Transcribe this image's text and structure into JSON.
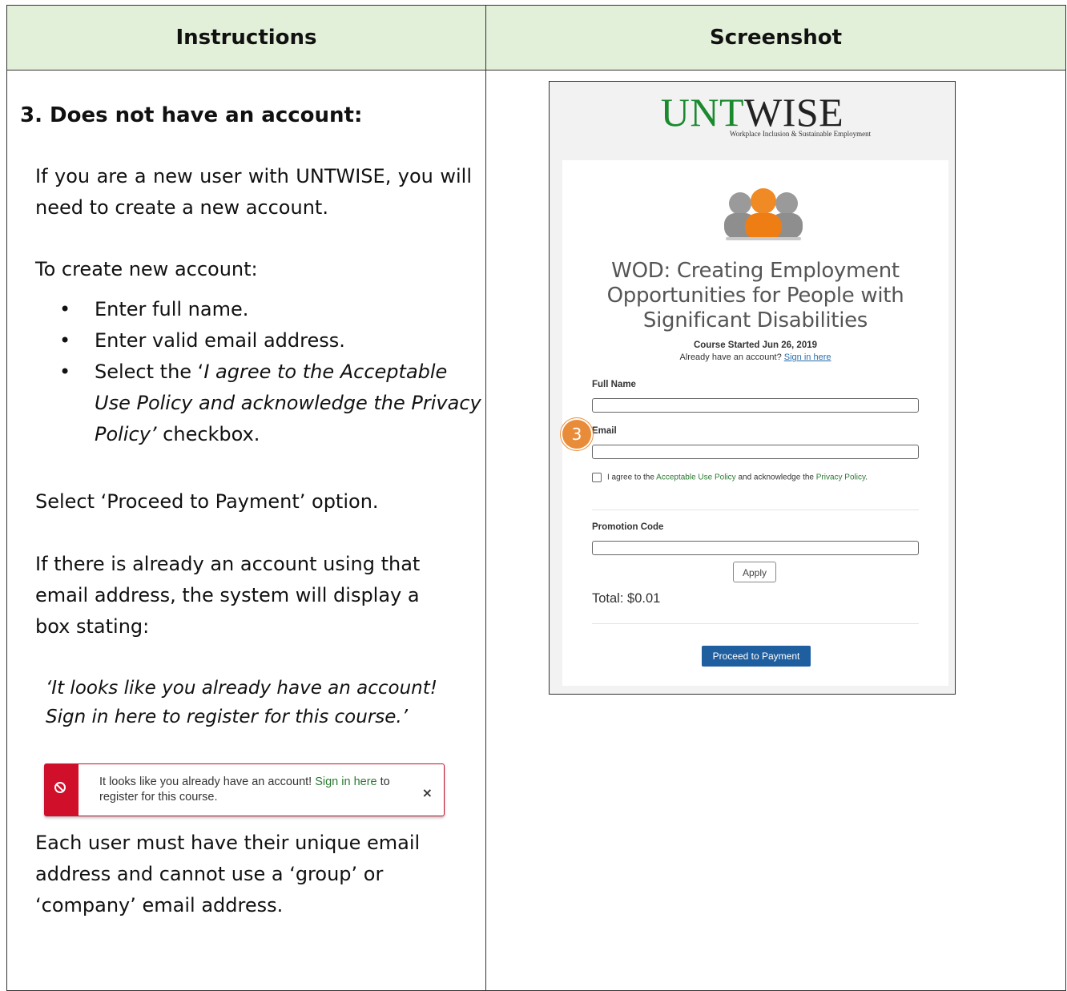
{
  "table": {
    "header_left": "Instructions",
    "header_right": "Screenshot"
  },
  "instructions": {
    "step_heading": "3.   Does not have an account:",
    "p1": "If you are a new user with UNTWISE, you will need to create a new account.",
    "p2": "To create new account:",
    "bullets": [
      "Enter full name.",
      "Enter valid email address."
    ],
    "bullet3_prefix": "Select the ‘",
    "bullet3_italic": "I agree to the Acceptable Use Policy and acknowledge the Privacy Policy’",
    "bullet3_suffix": " checkbox.",
    "p3": "Select ‘Proceed to Payment’ option.",
    "p4": "If there is already an account using that email address, the system will display a box stating:",
    "quote": "‘It looks like you already have an account! Sign in here to register for this course.’",
    "p5": "Each user must have their unique email address and cannot use a ‘group’ or ‘company’ email address."
  },
  "alert": {
    "text_before": "It looks like you already have an account! ",
    "link": "Sign in here",
    "text_after": " to register for this course.",
    "close": "×"
  },
  "screenshot": {
    "logo_unt": "UNT",
    "logo_wise": "WISE",
    "logo_tagline": "Workplace Inclusion & Sustainable Employment",
    "course_title": "WOD: Creating Employment Opportunities for People with Significant Disabilities",
    "course_started": "Course Started Jun 26, 2019",
    "already_text": "Already have an account? ",
    "sign_in_link": "Sign in here",
    "full_name_label": "Full Name",
    "email_label": "Email",
    "agree_prefix": "I agree to the ",
    "agree_link1": "Acceptable Use Policy",
    "agree_middle": " and acknowledge the ",
    "agree_link2": "Privacy Policy",
    "agree_suffix": ".",
    "promo_label": "Promotion Code",
    "apply_label": "Apply",
    "total": "Total: $0.01",
    "proceed_label": "Proceed to Payment",
    "step_badge": "3"
  },
  "colors": {
    "header_bg": "#e2efd9",
    "logo_green": "#1b8a2f",
    "alert_red": "#d0102a",
    "button_blue": "#1f5fa0",
    "badge_orange": "#e98c3a"
  }
}
